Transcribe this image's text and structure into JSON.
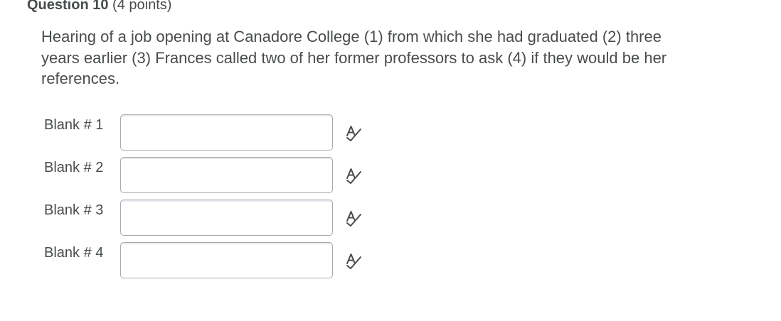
{
  "question": {
    "title": "Question 10",
    "points": "(4 points)",
    "text": "Hearing of a job opening at Canadore College (1) from which she had graduated (2) three years earlier (3) Frances called two of her former professors to ask (4) if they would be her references."
  },
  "blanks": [
    {
      "label": "Blank # 1",
      "value": "",
      "icon": "spellcheck-icon"
    },
    {
      "label": "Blank # 2",
      "value": "",
      "icon": "spellcheck-icon"
    },
    {
      "label": "Blank # 3",
      "value": "",
      "icon": "spellcheck-icon"
    },
    {
      "label": "Blank # 4",
      "value": "",
      "icon": "spellcheck-icon"
    }
  ],
  "colors": {
    "text": "#494c4e",
    "input_border": "#a7abad",
    "icon": "#494c4e"
  }
}
